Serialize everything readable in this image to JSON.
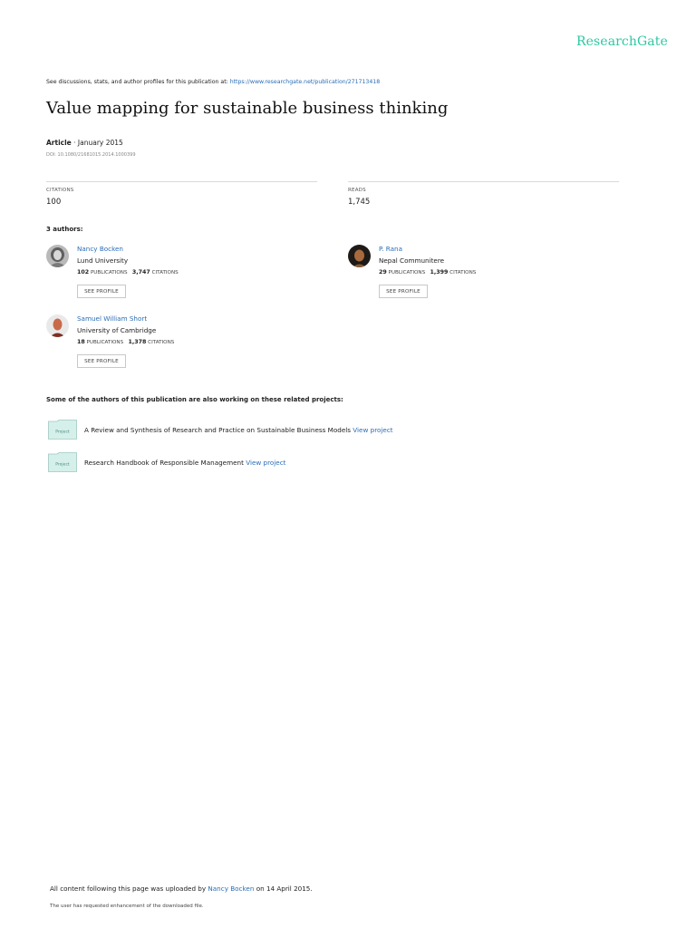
{
  "header": {
    "logo_text": "ResearchGate",
    "discuss_prefix": "See discussions, stats, and author profiles for this publication at:",
    "discuss_url": "https://www.researchgate.net/publication/271713418"
  },
  "publication": {
    "title": "Value mapping for sustainable business thinking",
    "type": "Article",
    "date_sep": " · ",
    "date": "January 2015",
    "doi": "DOI: 10.1080/21681015.2014.1000399"
  },
  "stats": {
    "citations_label": "CITATIONS",
    "citations_value": "100",
    "reads_label": "READS",
    "reads_value": "1,745"
  },
  "authors_heading": "3 authors:",
  "authors": [
    {
      "name": "Nancy Bocken",
      "institution": "Lund University",
      "publications": "102",
      "publications_label": "PUBLICATIONS",
      "citations": "3,747",
      "citations_label": "CITATIONS",
      "button": "SEE PROFILE"
    },
    {
      "name": "P. Rana",
      "institution": "Nepal Communitere",
      "publications": "29",
      "publications_label": "PUBLICATIONS",
      "citations": "1,399",
      "citations_label": "CITATIONS",
      "button": "SEE PROFILE"
    },
    {
      "name": "Samuel William Short",
      "institution": "University of Cambridge",
      "publications": "18",
      "publications_label": "PUBLICATIONS",
      "citations": "1,378",
      "citations_label": "CITATIONS",
      "button": "SEE PROFILE"
    }
  ],
  "related": {
    "heading": "Some of the authors of this publication are also working on these related projects:",
    "icon_label": "Project",
    "projects": [
      {
        "title": "A Review and Synthesis of Research and Practice on Sustainable Business Models",
        "link": "View project"
      },
      {
        "title": "Research Handbook of Responsible Management",
        "link": "View project"
      }
    ]
  },
  "footer": {
    "uploaded_prefix": "All content following this page was uploaded by",
    "uploader": "Nancy Bocken",
    "uploaded_suffix": "on 14 April 2015.",
    "enhancement_note": "The user has requested enhancement of the downloaded file."
  },
  "colors": {
    "brand": "#2cc7a3",
    "link": "#2a6db5",
    "project_icon": "#cfeee8"
  }
}
